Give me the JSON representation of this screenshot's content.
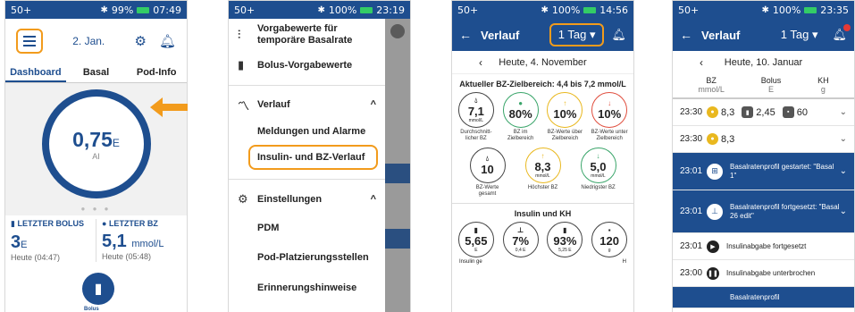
{
  "colors": {
    "primary": "#1e4e8f",
    "highlight": "#f29b1c",
    "green": "#3aa56a",
    "yellow": "#e9b81f",
    "red": "#e04f3f"
  },
  "screen1": {
    "status": {
      "left": "50+",
      "battery": "99%",
      "time": "07:49"
    },
    "date": "2. Jan.",
    "tabs": [
      "Dashboard",
      "Basal",
      "Pod-Info"
    ],
    "iob_value": "0,75",
    "iob_unit": "E",
    "iob_label": "AI",
    "last_bolus": {
      "header": "LETZTER BOLUS",
      "value": "3",
      "unit": "E",
      "time": "Heute (04:47)"
    },
    "last_bz": {
      "header": "LETZTER BZ",
      "value": "5,1",
      "unit": "mmol/L",
      "time": "Heute (05:48)"
    },
    "bolus_button": "Bolus"
  },
  "screen2": {
    "status": {
      "left": "50+",
      "battery": "100%",
      "time": "23:19"
    },
    "items": {
      "basal_presets": "Vorgabewerte für temporäre Basalrate",
      "bolus_presets": "Bolus-Vorgabewerte",
      "verlauf": "Verlauf",
      "alarms": "Meldungen und Alarme",
      "insulin_bz": "Insulin- und BZ-Verlauf",
      "settings": "Einstellungen",
      "pdm": "PDM",
      "pod_sites": "Pod-Platzierungsstellen",
      "reminders": "Erinnerungshinweise"
    }
  },
  "screen3": {
    "status": {
      "left": "50+",
      "battery": "100%",
      "time": "14:56"
    },
    "title": "Verlauf",
    "range": "1 Tag",
    "date": "Heute, 4. November",
    "ziel": "Aktueller BZ-Zielbereich: 4,4 bis 7,2 mmol/L",
    "stats1": [
      {
        "value": "7,1",
        "unit": "mmol/L",
        "caption": "Durchschnitt-licher BZ"
      },
      {
        "value": "80%",
        "unit": "",
        "caption": "BZ im Zielbereich"
      },
      {
        "value": "10%",
        "unit": "",
        "caption": "BZ-Werte über Zielbereich"
      },
      {
        "value": "10%",
        "unit": "",
        "caption": "BZ-Werte unter Zielbereich"
      }
    ],
    "stats2": [
      {
        "value": "10",
        "unit": "",
        "caption": "BZ-Werte gesamt"
      },
      {
        "value": "8,3",
        "unit": "mmol/L",
        "caption": "Höchster BZ"
      },
      {
        "value": "5,0",
        "unit": "mmol/L",
        "caption": "Niedrigster BZ"
      }
    ],
    "insulin_header": "Insulin und KH",
    "stats3": [
      {
        "value": "5,65",
        "unit": "E"
      },
      {
        "value": "7%",
        "unit": "0,4 E"
      },
      {
        "value": "93%",
        "unit": "5,25 E"
      },
      {
        "value": "120",
        "unit": "g"
      }
    ],
    "bottom_left": "Insulin ge",
    "bottom_right": "H"
  },
  "screen4": {
    "status": {
      "left": "50+",
      "battery": "100%",
      "time": "23:35"
    },
    "title": "Verlauf",
    "range": "1 Tag",
    "date": "Heute, 10. Januar",
    "cols": [
      {
        "label": "BZ",
        "unit": "mmol/L"
      },
      {
        "label": "Bolus",
        "unit": "E"
      },
      {
        "label": "KH",
        "unit": "g"
      }
    ],
    "row1": {
      "time": "23:30",
      "bz": "8,3",
      "bolus": "2,45",
      "kh": "60"
    },
    "row2": {
      "time": "23:30",
      "bz": "8,3"
    },
    "event1": {
      "time": "23:01",
      "text": "Basalratenprofil gestartet: \"Basal 1\""
    },
    "event2": {
      "time": "23:01",
      "text": "Basalratenprofil fortgesetzt: \"Basal 26 edit\""
    },
    "event3": {
      "time": "23:01",
      "text": "Insulinabgabe fortgesetzt"
    },
    "event4": {
      "time": "23:00",
      "text": "Insulinabgabe unterbrochen"
    },
    "event5": {
      "text": "Basalratenprofil"
    }
  }
}
